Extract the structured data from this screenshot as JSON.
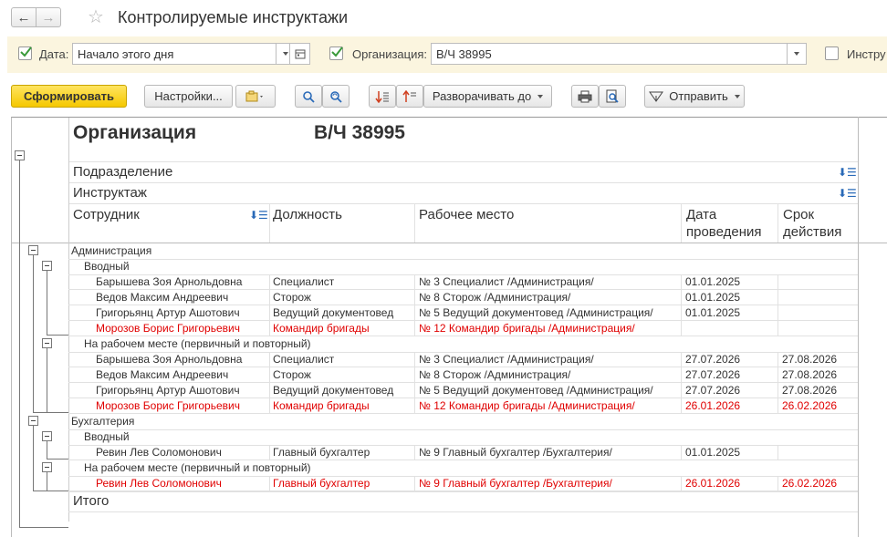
{
  "window": {
    "title": "Контролируемые инструктажи",
    "back_icon": "←",
    "forward_icon": "→",
    "star_icon": "☆"
  },
  "filters": {
    "date_label": "Дата:",
    "date_value": "Начало этого дня",
    "org_label": "Организация:",
    "org_value": "В/Ч 38995",
    "instr_label": "Инстру"
  },
  "toolbar": {
    "generate": "Сформировать",
    "settings": "Настройки...",
    "expand_to": "Разворачивать до",
    "send": "Отправить"
  },
  "report": {
    "org_label": "Организация",
    "org_value": "В/Ч 38995",
    "group1_header": "Подразделение",
    "group2_header": "Инструктаж",
    "columns": [
      "Сотрудник",
      "Должность",
      "Рабочее место",
      "Дата",
      "проведения",
      "Срок",
      "действия"
    ],
    "total": "Итого",
    "groups": [
      {
        "name": "Администрация"
      },
      {
        "name": "Бухгалтерия"
      }
    ],
    "subgroups": [
      "Вводный",
      "На рабочем месте (первичный и повторный)",
      "Вводный",
      "На рабочем месте (первичный и повторный)"
    ],
    "rows": [
      {
        "employee": "Барышева Зоя Арнольдовна",
        "position": "Специалист",
        "workplace": "№ 3 Специалист /Администрация/",
        "date": "01.01.2025",
        "term": "",
        "red": false
      },
      {
        "employee": "Ведов Максим Андреевич",
        "position": "Сторож",
        "workplace": "№ 8 Сторож /Администрация/",
        "date": "01.01.2025",
        "term": "",
        "red": false
      },
      {
        "employee": "Григорьянц Артур Ашотович",
        "position": "Ведущий документовед",
        "workplace": "№ 5 Ведущий документовед /Администрация/",
        "date": "01.01.2025",
        "term": "",
        "red": false
      },
      {
        "employee": "Морозов Борис Григорьевич",
        "position": "Командир бригады",
        "workplace": "№ 12 Командир бригады /Администрация/",
        "date": "",
        "term": "",
        "red": true
      },
      {
        "employee": "Барышева Зоя Арнольдовна",
        "position": "Специалист",
        "workplace": "№ 3 Специалист /Администрация/",
        "date": "27.07.2026",
        "term": "27.08.2026",
        "red": false
      },
      {
        "employee": "Ведов Максим Андреевич",
        "position": "Сторож",
        "workplace": "№ 8 Сторож /Администрация/",
        "date": "27.07.2026",
        "term": "27.08.2026",
        "red": false
      },
      {
        "employee": "Григорьянц Артур Ашотович",
        "position": "Ведущий документовед",
        "workplace": "№ 5 Ведущий документовед /Администрация/",
        "date": "27.07.2026",
        "term": "27.08.2026",
        "red": false
      },
      {
        "employee": "Морозов Борис Григорьевич",
        "position": "Командир бригады",
        "workplace": "№ 12 Командир бригады /Администрация/",
        "date": "26.01.2026",
        "term": "26.02.2026",
        "red": true
      },
      {
        "employee": "Ревин Лев Соломонович",
        "position": "Главный бухгалтер",
        "workplace": "№ 9 Главный бухгалтер /Бухгалтерия/",
        "date": "01.01.2025",
        "term": "",
        "red": false
      },
      {
        "employee": "Ревин Лев Соломонович",
        "position": "Главный бухгалтер",
        "workplace": "№ 9 Главный бухгалтер /Бухгалтерия/",
        "date": "26.01.2026",
        "term": "26.02.2026",
        "red": true
      }
    ]
  },
  "colors": {
    "accent_yellow": "#f5c800",
    "filter_bg": "#fbf5df",
    "overdue_red": "#e00000",
    "check_green": "#3a9a3a"
  }
}
